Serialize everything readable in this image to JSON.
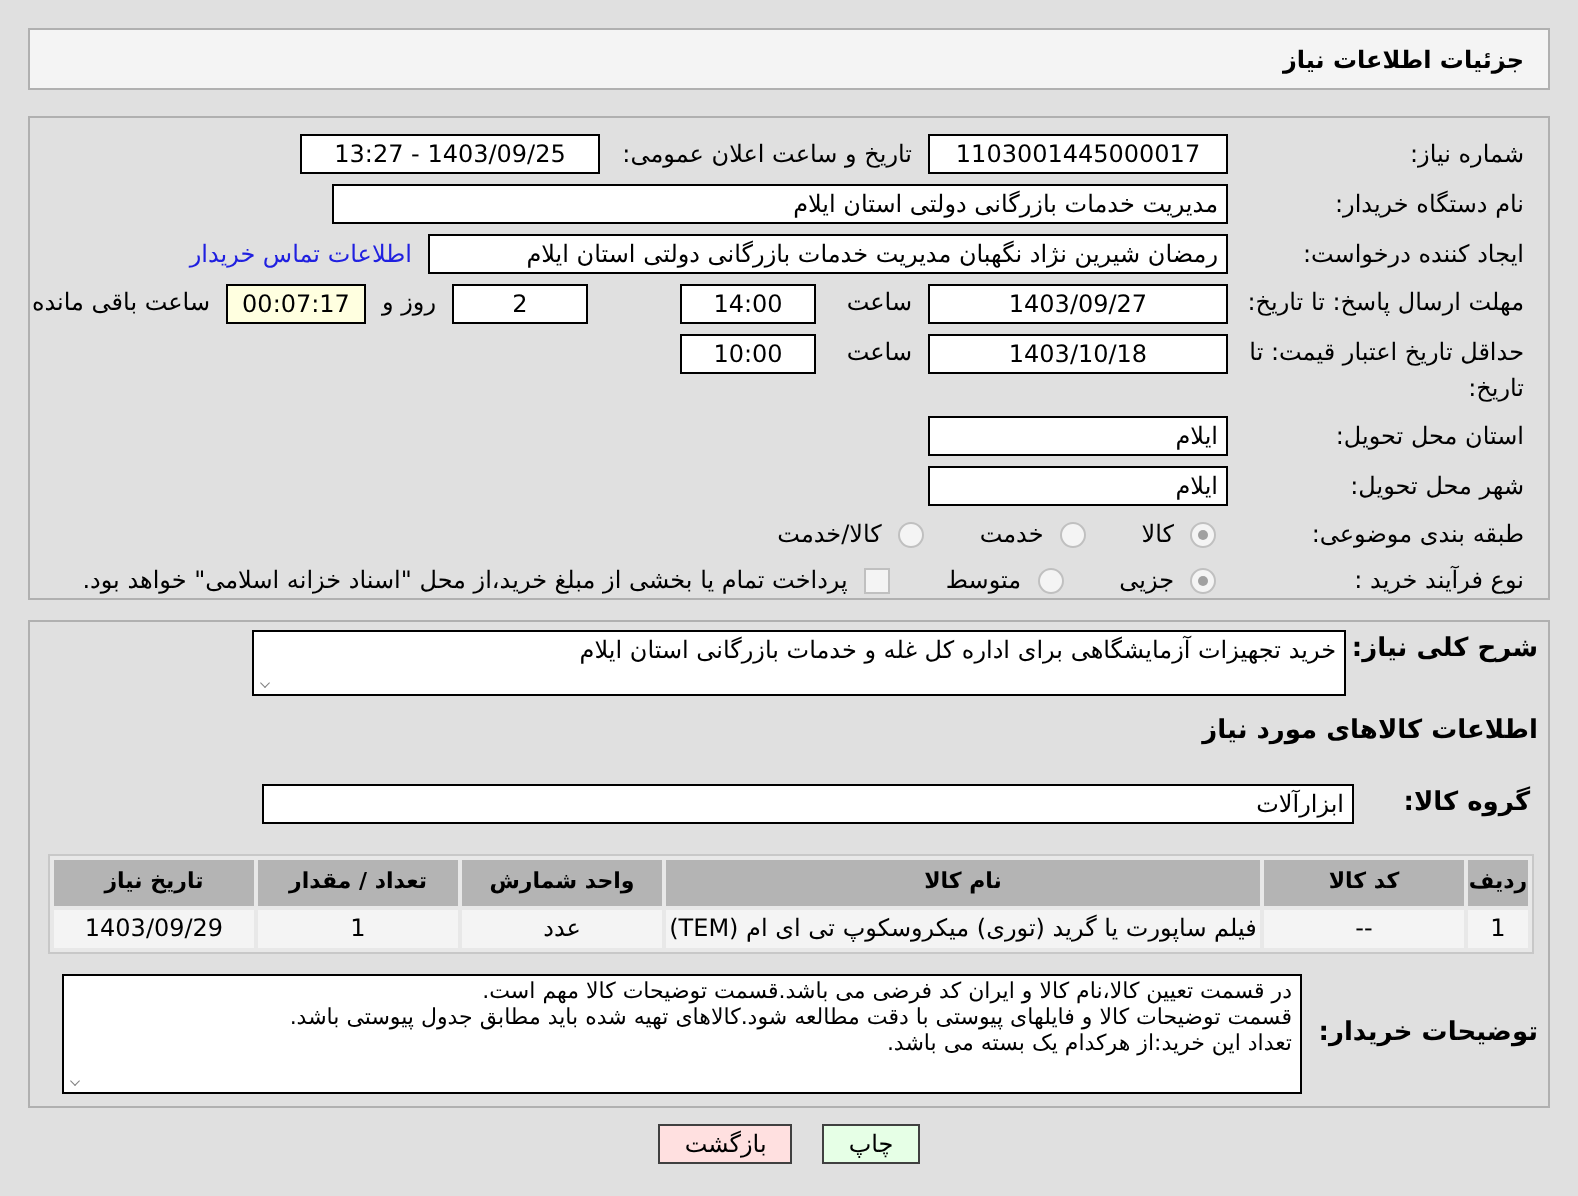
{
  "header": {
    "title": "جزئیات اطلاعات نیاز"
  },
  "details": {
    "need_number": {
      "label": "شماره نیاز:",
      "value": "1103001445000017"
    },
    "announce": {
      "label": "تاریخ و ساعت اعلان عمومی:",
      "value": "1403/09/25 - 13:27"
    },
    "buyer": {
      "label": "نام دستگاه خریدار:",
      "value": "مدیریت خدمات بازرگانی دولتی استان ایلام"
    },
    "creator": {
      "label": "ایجاد کننده درخواست:",
      "value": "رمضان شیرین نژاد نگهبان مدیریت خدمات بازرگانی دولتی استان ایلام",
      "link": "اطلاعات تماس خریدار"
    },
    "deadline": {
      "label": "مهلت ارسال پاسخ: تا تاریخ:",
      "date": "1403/09/27",
      "time_label": "ساعت",
      "time": "14:00",
      "days": "2",
      "days_label": "روز و",
      "remaining": "00:07:17",
      "remaining_label": "ساعت باقی مانده"
    },
    "validity": {
      "label": "حداقل تاریخ اعتبار قیمت: تا تاریخ:",
      "date": "1403/10/18",
      "time_label": "ساعت",
      "time": "10:00"
    },
    "province": {
      "label": "استان محل تحویل:",
      "value": "ایلام"
    },
    "city": {
      "label": "شهر محل تحویل:",
      "value": "ایلام"
    },
    "category": {
      "label": "طبقه بندی موضوعی:",
      "options": [
        {
          "label": "کالا",
          "selected": true
        },
        {
          "label": "خدمت",
          "selected": false
        },
        {
          "label": "کالا/خدمت",
          "selected": false
        }
      ]
    },
    "process": {
      "label": "نوع فرآیند خرید :",
      "options": [
        {
          "label": "جزیی",
          "selected": true
        },
        {
          "label": "متوسط",
          "selected": false
        }
      ],
      "treasury": {
        "label": "پرداخت تمام یا بخشی از مبلغ خرید،از محل \"اسناد خزانه اسلامی\" خواهد بود.",
        "checked": false
      }
    }
  },
  "goods": {
    "summary": {
      "label": "شرح کلی نیاز:",
      "value": "خرید تجهیزات آزمایشگاهی برای اداره کل غله و خدمات بازرگانی استان ایلام"
    },
    "heading": "اطلاعات کالاهای مورد نیاز",
    "group": {
      "label": "گروه کالا:",
      "value": "ابزارآلات"
    },
    "table": {
      "columns": [
        "ردیف",
        "کد کالا",
        "نام کالا",
        "واحد شمارش",
        "تعداد / مقدار",
        "تاریخ نیاز"
      ],
      "rows": [
        [
          "1",
          "--",
          "فیلم ساپورت یا گرید (توری) میکروسکوپ تی ای ام (TEM)",
          "عدد",
          "1",
          "1403/09/29"
        ]
      ]
    },
    "notes": {
      "label": "توضیحات خریدار:",
      "lines": [
        "در قسمت تعیین کالا،نام کالا و ایران کد فرضی می باشد.قسمت توضیحات کالا مهم است.",
        "قسمت توضیحات کالا و فایلهای پیوستی با دقت مطالعه شود.کالاهای تهیه شده باید مطابق جدول پیوستی باشد.",
        "تعداد این خرید:از هرکدام یک بسته می باشد."
      ]
    }
  },
  "buttons": [
    {
      "label": "چاپ",
      "kind": "print"
    },
    {
      "label": "بازگشت",
      "kind": "back"
    }
  ]
}
